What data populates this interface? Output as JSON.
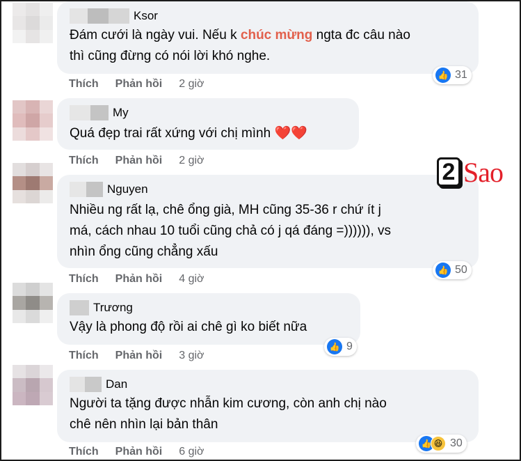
{
  "comments": [
    {
      "name": "Ksor",
      "lines": [
        [
          "Đám cưới là ngày vui. Nếu k ",
          "chúc mừng",
          " ngta đc câu nào"
        ],
        [
          "thì cũng đừng có nói lời khó nghe."
        ]
      ],
      "reaction_count": "31",
      "like_label": "Thích",
      "reply_label": "Phản hồi",
      "time": "2 giờ"
    },
    {
      "name": "My",
      "lines": [
        [
          "Quá đẹp trai rất xứng với chị mình ❤️❤️"
        ]
      ],
      "reaction_count": "",
      "like_label": "Thích",
      "reply_label": "Phản hồi",
      "time": "2 giờ"
    },
    {
      "name": "Nguyen",
      "lines": [
        [
          "Nhiều ng rất lạ, chê ổng già, MH cũng 35-36 r chứ ít j"
        ],
        [
          "má, cách nhau 10 tuổi cũng chả có j qá đáng =)))))), vs"
        ],
        [
          "nhìn ổng cũng chẳng xấu"
        ]
      ],
      "reaction_count": "50",
      "like_label": "Thích",
      "reply_label": "Phản hồi",
      "time": "4 giờ"
    },
    {
      "name": "Trương",
      "lines": [
        [
          "Vậy là phong độ rồi ai chê gì ko biết nữa"
        ]
      ],
      "reaction_count": "9",
      "like_label": "Thích",
      "reply_label": "Phản hồi",
      "time": "3 giờ"
    },
    {
      "name": "Dan",
      "lines": [
        [
          "Người ta tặng được nhẫn kim cương, còn anh chị nào"
        ],
        [
          "chê nên nhìn lại bản thân"
        ]
      ],
      "reaction_count": "30",
      "like_label": "Thích",
      "reply_label": "Phản hồi",
      "time": "6 giờ"
    }
  ],
  "watermark": {
    "digit": "2",
    "word": "Sao"
  },
  "icons": {
    "like": "thumbs-up-icon",
    "haha": "haha-emoji-icon"
  },
  "colors": {
    "bubble": "#f0f2f5",
    "like_blue": "#1877f2",
    "highlight": "#e2604c",
    "logo_red": "#e3202a"
  }
}
